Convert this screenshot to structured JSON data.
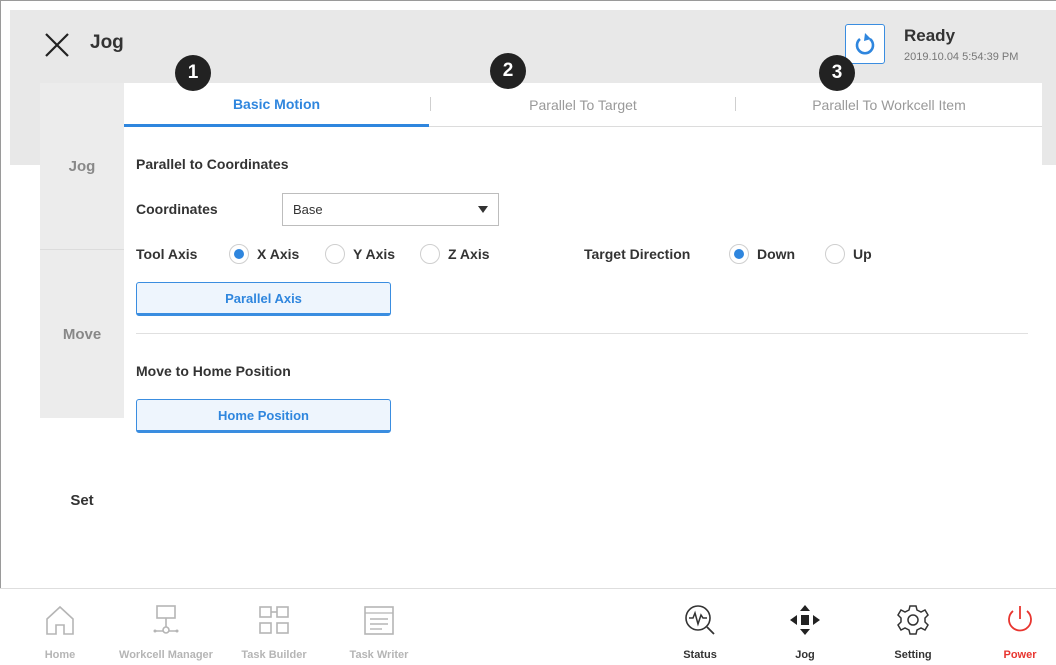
{
  "header": {
    "title": "Jog",
    "status_label": "Ready",
    "status_time": "2019.10.04 5:54:39 PM"
  },
  "markers": [
    "1",
    "2",
    "3"
  ],
  "side_tabs": [
    {
      "label": "Jog",
      "active": false
    },
    {
      "label": "Move",
      "active": false
    },
    {
      "label": "Set",
      "active": true
    }
  ],
  "tabs": [
    {
      "label": "Basic Motion",
      "active": true
    },
    {
      "label": "Parallel To Target",
      "active": false
    },
    {
      "label": "Parallel To Workcell Item",
      "active": false
    }
  ],
  "parallel": {
    "section_title": "Parallel to Coordinates",
    "coordinates_label": "Coordinates",
    "coordinates_value": "Base",
    "tool_axis_label": "Tool Axis",
    "tool_axis_options": [
      "X Axis",
      "Y Axis",
      "Z Axis"
    ],
    "tool_axis_selected": "X Axis",
    "target_direction_label": "Target Direction",
    "target_direction_options": [
      "Down",
      "Up"
    ],
    "target_direction_selected": "Down",
    "button": "Parallel Axis"
  },
  "home": {
    "section_title": "Move to Home Position",
    "button": "Home Position"
  },
  "bottom_nav": {
    "home": "Home",
    "workcell_manager": "Workcell Manager",
    "task_builder": "Task Builder",
    "task_writer": "Task Writer",
    "status": "Status",
    "jog": "Jog",
    "setting": "Setting",
    "power": "Power"
  },
  "colors": {
    "accent": "#2f86de",
    "power": "#e8352f",
    "disabled": "#b5b5b5"
  }
}
